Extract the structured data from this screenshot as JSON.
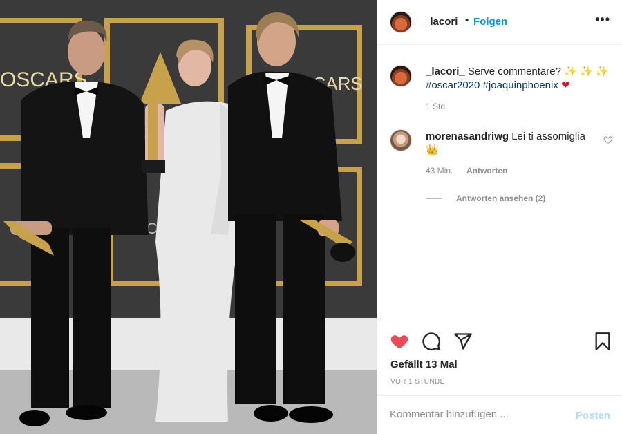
{
  "photo": {
    "backdrop_text_left": "OSCARS",
    "backdrop_text_right": "SCARS",
    "backdrop_text_mid": "OSC"
  },
  "header": {
    "username": "_lacori_",
    "separator": "•",
    "follow_label": "Folgen",
    "more_label": "•••"
  },
  "caption": {
    "username": "_lacori_",
    "text": "Serve commentare?",
    "sparkles": "✨ ✨ ✨",
    "hashtags": "#oscar2020 #joaquinphoenix",
    "heart": "❤",
    "time": "1 Std."
  },
  "comments": [
    {
      "username": "morenasandriwg",
      "text": "Lei ti assomiglia",
      "crown": "👑",
      "time": "43 Min.",
      "reply_label": "Antworten",
      "view_replies_label": "Antworten ansehen (2)"
    }
  ],
  "actions": {
    "like_icon": "heart-filled-icon",
    "comment_icon": "comment-icon",
    "share_icon": "paper-plane-icon",
    "save_icon": "bookmark-icon",
    "likes_text": "Gefällt 13 Mal",
    "post_date": "VOR 1 STUNDE",
    "like_color": "#ed4956"
  },
  "add_comment": {
    "placeholder": "Kommentar hinzufügen ...",
    "post_label": "Posten"
  },
  "colors": {
    "accent": "#0095f6",
    "hashtag": "#00376b",
    "muted": "#8e8e8e",
    "post_disabled": "#b2dffc"
  }
}
